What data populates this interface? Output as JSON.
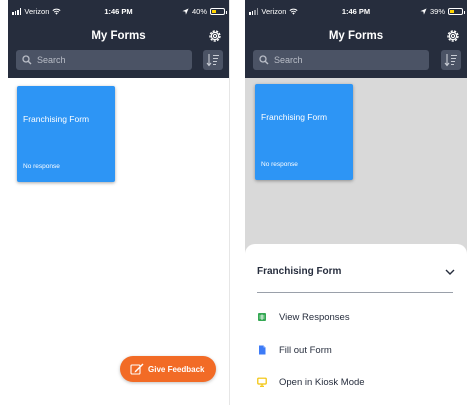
{
  "screens": {
    "left": {
      "status": {
        "carrier": "Verizon",
        "time": "1:46 PM",
        "battery": "40%",
        "battery_level": 0.4
      },
      "header": {
        "title": "My Forms"
      },
      "search": {
        "placeholder": "Search"
      },
      "forms": [
        {
          "title": "Franchising Form",
          "status": "No response"
        }
      ],
      "feedback_button": {
        "label": "Give Feedback"
      }
    },
    "right": {
      "status": {
        "carrier": "Verizon",
        "time": "1:46 PM",
        "battery": "39%",
        "battery_level": 0.39
      },
      "header": {
        "title": "My Forms"
      },
      "search": {
        "placeholder": "Search"
      },
      "forms": [
        {
          "title": "Franchising Form",
          "status": "No response"
        }
      ],
      "sheet": {
        "title": "Franchising Form",
        "items": [
          {
            "label": "View Responses",
            "icon": "spreadsheet-icon"
          },
          {
            "label": "Fill out Form",
            "icon": "document-icon"
          },
          {
            "label": "Open in Kiosk Mode",
            "icon": "monitor-icon"
          }
        ]
      }
    }
  },
  "colors": {
    "header_bg": "#262d3d",
    "card_bg": "#2d95f5",
    "feedback_bg": "#f26b26",
    "battery_fill": "#ffd400",
    "icon_green": "#34a853",
    "icon_blue": "#3d7bf7",
    "icon_yellow": "#f2c200"
  }
}
